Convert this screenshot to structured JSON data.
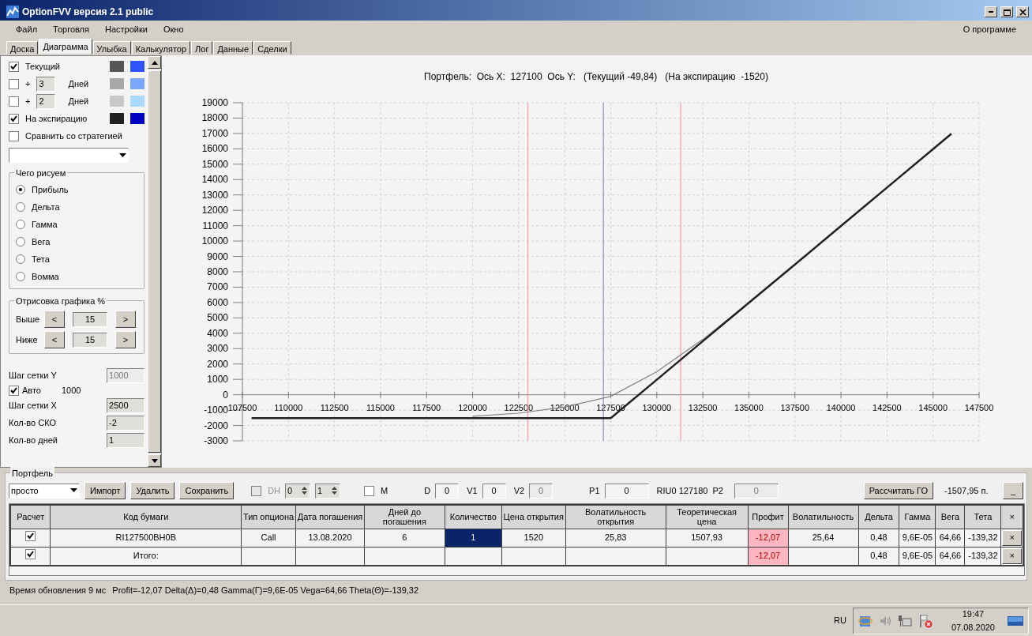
{
  "window": {
    "title": "OptionFVV версия 2.1 public"
  },
  "menu": [
    {
      "label": "Файл"
    },
    {
      "label": "Торговля"
    },
    {
      "label": "Настройки"
    },
    {
      "label": "Окно"
    }
  ],
  "menu_right": {
    "label": "О программе"
  },
  "tabs": [
    {
      "label": "Доска",
      "selected": false
    },
    {
      "label": "Диаграмма",
      "selected": true
    },
    {
      "label": "Улыбка",
      "selected": false
    },
    {
      "label": "Калькулятор",
      "selected": false
    },
    {
      "label": "Лог",
      "selected": false
    },
    {
      "label": "Данные",
      "selected": false
    },
    {
      "label": "Сделки",
      "selected": false
    }
  ],
  "sidebar": {
    "curves": [
      {
        "kind": "named",
        "label": "Текущий",
        "checked": true,
        "swatches": [
          {
            "color": "#555555"
          },
          {
            "color": "#2f54ff"
          }
        ]
      },
      {
        "kind": "days",
        "plus": "+",
        "days": "3",
        "label": "Дней",
        "checked": false,
        "swatches": [
          {
            "color": "#a8a8a8"
          },
          {
            "color": "#7aa8ff"
          }
        ]
      },
      {
        "kind": "days",
        "plus": "+",
        "days": "2",
        "label": "Дней",
        "checked": false,
        "swatches": [
          {
            "color": "#c8c8c8"
          },
          {
            "color": "#aad8ff"
          }
        ]
      },
      {
        "kind": "named",
        "label": "На экспирацию",
        "checked": true,
        "swatches": [
          {
            "color": "#222222"
          },
          {
            "color": "#0000c0"
          }
        ]
      }
    ],
    "compare": {
      "label": "Сравнить со стратегией",
      "checked": false
    },
    "draw_group": {
      "title": "Чего рисуем",
      "options": [
        {
          "label": "Прибыль",
          "selected": true
        },
        {
          "label": "Дельта",
          "selected": false
        },
        {
          "label": "Гамма",
          "selected": false
        },
        {
          "label": "Вега",
          "selected": false
        },
        {
          "label": "Тета",
          "selected": false
        },
        {
          "label": "Вомма",
          "selected": false
        }
      ]
    },
    "range_group": {
      "title": "Отрисовка графика %",
      "rows": [
        {
          "label": "Выше",
          "dec": "<",
          "value": "15",
          "inc": ">"
        },
        {
          "label": "Ниже",
          "dec": "<",
          "value": "15",
          "inc": ">"
        }
      ]
    },
    "grid_y": {
      "label": "Шаг сетки Y",
      "value": "1000",
      "disabled": true
    },
    "auto": {
      "label": "Авто",
      "checked": true,
      "value": "1000"
    },
    "fields": [
      {
        "label": "Шаг сетки X",
        "value": "2500",
        "disabled": false
      },
      {
        "label": "Кол-во СКО",
        "value": "-2",
        "disabled": false
      },
      {
        "label": "Кол-во дней",
        "value": "1",
        "disabled": false
      }
    ]
  },
  "chart": {
    "chart_data": {
      "type": "line",
      "title": "Портфель:  Ось X:  127100  Ось Y:   (Текущий -49,84)   (На экспирацию  -1520)",
      "x": [
        108000,
        112500,
        117500,
        120000,
        122500,
        125000,
        127500,
        130000,
        132500,
        135000,
        137500,
        140000,
        142500,
        146000
      ],
      "series": [
        {
          "color": "#808080",
          "values": [
            null,
            null,
            null,
            -1400,
            -1200,
            -800,
            -100,
            1500,
            3600,
            6000,
            null,
            null,
            null,
            null
          ]
        },
        {
          "color": "#202020",
          "values": [
            -1520,
            -1520,
            -1520,
            -1520,
            -1520,
            -1520,
            -1520,
            980,
            3480,
            5980,
            8480,
            10980,
            13480,
            16980
          ]
        }
      ],
      "xlim": [
        107500,
        147500
      ],
      "ylim": [
        -3000,
        19000
      ],
      "grid": true,
      "xticks": [
        107500,
        110000,
        112500,
        115000,
        117500,
        120000,
        122500,
        125000,
        127500,
        130000,
        132500,
        135000,
        137500,
        140000,
        142500,
        145000,
        147500
      ],
      "yticks": [
        -3000,
        -2000,
        -1000,
        0,
        1000,
        2000,
        3000,
        4000,
        5000,
        6000,
        7000,
        8000,
        9000,
        10000,
        11000,
        12000,
        13000,
        14000,
        15000,
        16000,
        17000,
        18000,
        19000
      ],
      "ref_lines": [
        {
          "axis": "x",
          "value": 123000,
          "color": "#ff9aaa"
        },
        {
          "axis": "x",
          "value": 131300,
          "color": "#ff9aaa"
        },
        {
          "axis": "x",
          "value": 127100,
          "color": "#9090b8"
        }
      ]
    }
  },
  "portfolio": {
    "title": "Портфель",
    "strategy": {
      "value": "просто"
    },
    "buttons": [
      {
        "label": "Импорт"
      },
      {
        "label": "Удалить"
      },
      {
        "label": "Сохранить"
      }
    ],
    "dh": {
      "label": "DH",
      "checked": false,
      "disabled": true
    },
    "spinners": [
      {
        "value": "0"
      },
      {
        "value": "1"
      }
    ],
    "m": {
      "label": "M",
      "checked": false
    },
    "params": [
      {
        "label": "D",
        "value": "0",
        "disabled": false
      },
      {
        "label": "V1",
        "value": "0",
        "disabled": false
      },
      {
        "label": "V2",
        "value": "0",
        "disabled": true
      },
      {
        "label": "P1",
        "value": "0",
        "disabled": false
      }
    ],
    "future": "RIU0 127180",
    "p2": {
      "label": "P2",
      "value": "0",
      "disabled": true
    },
    "calc_button": {
      "label": "Рассчитать ГО"
    },
    "margin": "-1507,95 п.",
    "minimize_button": {
      "label": "_"
    },
    "table": {
      "columns": [
        "Расчет",
        "Код бумаги",
        "Тип опциона",
        "Дата погашения",
        "Дней до погашения",
        "Количество",
        "Цена открытия",
        "Волатильность открытия",
        "Теоретическая цена",
        "Профит",
        "Волатильность",
        "Дельта",
        "Гамма",
        "Вега",
        "Тета",
        "×"
      ],
      "rows": [
        {
          "checked": true,
          "quantity_selected": true,
          "loss": true,
          "cells": [
            "",
            "RI127500BH0B",
            "Call",
            "13.08.2020",
            "6",
            "1",
            "1520",
            "25,83",
            "1507,93",
            "-12,07",
            "25,64",
            "0,48",
            "9,6E-05",
            "64,66",
            "-139,32",
            "×"
          ]
        },
        {
          "checked": true,
          "quantity_selected": false,
          "loss": true,
          "cells": [
            "",
            "Итого:",
            "",
            "",
            "",
            "",
            "",
            "",
            "",
            "-12,07",
            "",
            "0,48",
            "9,6E-05",
            "64,66",
            "-139,32",
            "×"
          ]
        }
      ]
    }
  },
  "status_bar": {
    "update": "Время обновления 9 мс",
    "summary": "Profit=-12,07 Delta(Δ)=0,48 Gamma(Γ)=9,6E-05 Vega=64,66 Theta(Θ)=-139,32"
  },
  "taskbar": {
    "language": "RU",
    "time": "19:47",
    "date": "07.08.2020"
  }
}
